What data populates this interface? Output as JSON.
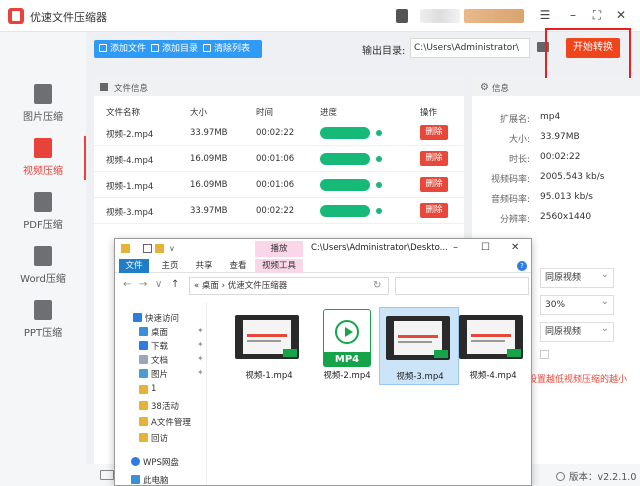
{
  "app": {
    "title": "优速文件压缩器",
    "window_controls": {
      "menu": "☰",
      "minimize": "–",
      "maximize": "⛶",
      "close": "✕"
    }
  },
  "sidebar": {
    "items": [
      {
        "label": "图片压缩",
        "icon": "image-file-icon",
        "active": false
      },
      {
        "label": "视频压缩",
        "icon": "video-file-icon",
        "active": true
      },
      {
        "label": "PDF压缩",
        "icon": "pdf-file-icon",
        "active": false
      },
      {
        "label": "Word压缩",
        "icon": "word-file-icon",
        "active": false
      },
      {
        "label": "PPT压缩",
        "icon": "ppt-file-icon",
        "active": false
      }
    ]
  },
  "toolbar": {
    "add_file": "添加文件",
    "add_dir": "添加目录",
    "clear_list": "清除列表",
    "output_label": "输出目录:",
    "output_path": "C:\\Users\\Administrator\\",
    "start_button": "开始转换"
  },
  "file_panel": {
    "title": "文件信息",
    "columns": [
      "文件名称",
      "大小",
      "时间",
      "进度",
      "操作"
    ],
    "rows": [
      {
        "name": "视频-2.mp4",
        "size": "33.97MB",
        "time": "00:02:22",
        "progress": 1.0,
        "action": "删除"
      },
      {
        "name": "视频-4.mp4",
        "size": "16.09MB",
        "time": "00:01:06",
        "progress": 1.0,
        "action": "删除"
      },
      {
        "name": "视频-1.mp4",
        "size": "16.09MB",
        "time": "00:01:06",
        "progress": 1.0,
        "action": "删除"
      },
      {
        "name": "视频-3.mp4",
        "size": "33.97MB",
        "time": "00:02:22",
        "progress": 1.0,
        "action": "删除"
      }
    ]
  },
  "info_panel": {
    "title": "信息",
    "rows": [
      {
        "key": "扩展名:",
        "value": "mp4"
      },
      {
        "key": "大小:",
        "value": "33.97MB"
      },
      {
        "key": "时长:",
        "value": "00:02:22"
      },
      {
        "key": "视频码率:",
        "value": "2005.543 kb/s"
      },
      {
        "key": "音频码率:",
        "value": "95.013 kb/s"
      },
      {
        "key": "分辨率:",
        "value": "2560x1440"
      }
    ]
  },
  "settings": {
    "select1": "同原视频",
    "select2": "30%",
    "select3": "同原视频",
    "hint": "设置越低视频压缩的越小"
  },
  "status": {
    "version": "版本：v2.2.1.0"
  },
  "explorer": {
    "context_tab": "播放",
    "title_path": "C:\\Users\\Administrator\\Deskto...",
    "ribbon_tabs": [
      "文件",
      "主页",
      "共享",
      "查看",
      "视频工具"
    ],
    "address": "« 桌面 › 优速文件压缩器",
    "tree": [
      {
        "label": "快速访问",
        "pinned": false
      },
      {
        "label": "桌面",
        "pinned": true
      },
      {
        "label": "下载",
        "pinned": true
      },
      {
        "label": "文档",
        "pinned": true
      },
      {
        "label": "图片",
        "pinned": true
      },
      {
        "label": "1",
        "pinned": false
      },
      {
        "label": "38活动",
        "pinned": false
      },
      {
        "label": "A文件管理",
        "pinned": false
      },
      {
        "label": "回访",
        "pinned": false
      },
      {
        "label": "WPS网盘",
        "pinned": false
      },
      {
        "label": "此电脑",
        "pinned": false
      }
    ],
    "files": [
      {
        "name": "视频-1.mp4",
        "kind": "video-thumbnail",
        "selected": false
      },
      {
        "name": "视频-2.mp4",
        "kind": "mp4-icon",
        "mp4_tag": "MP4",
        "selected": false
      },
      {
        "name": "视频-3.mp4",
        "kind": "video-thumbnail",
        "selected": true
      },
      {
        "name": "视频-4.mp4",
        "kind": "video-thumbnail",
        "selected": false
      }
    ]
  },
  "colors": {
    "accent_red": "#e8423a",
    "start_orange": "#f0451c",
    "toolbar_blue": "#2f9bf5",
    "progress_green": "#17b978"
  }
}
